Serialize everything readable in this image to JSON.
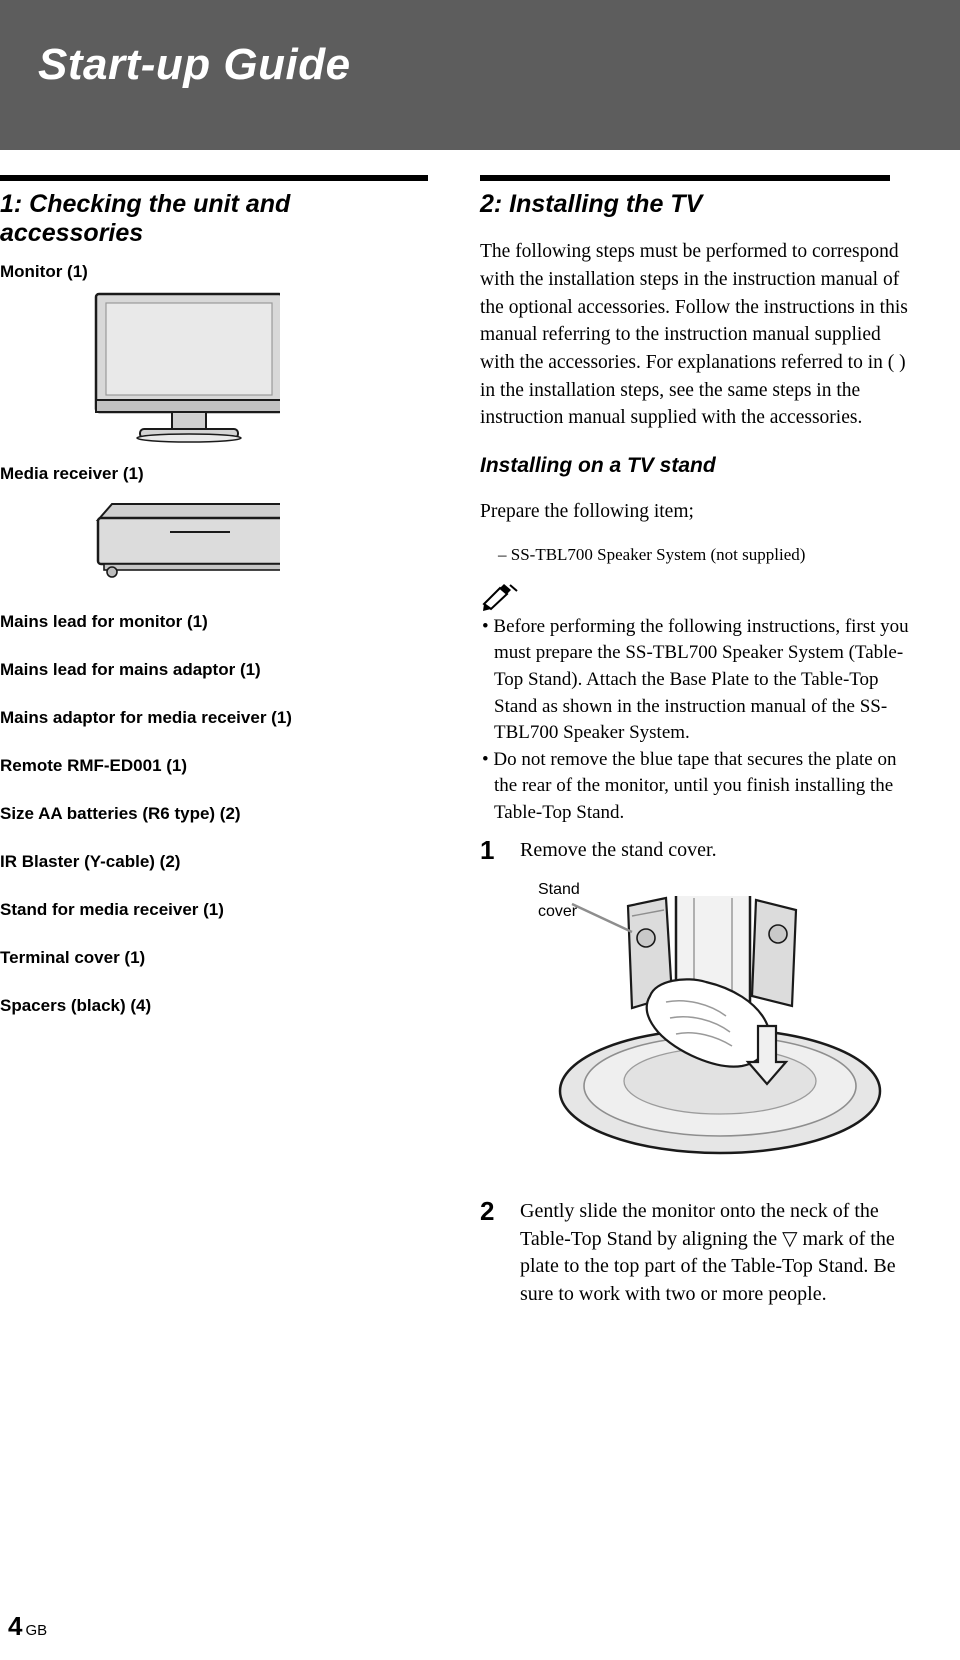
{
  "header": {
    "title": "Start-up Guide"
  },
  "left": {
    "section_title": "1: Checking the unit and accessories",
    "monitor_label": "Monitor (1)",
    "media_receiver_label": "Media receiver (1)",
    "accessories": [
      "Mains lead for monitor (1)",
      "Mains lead for mains adaptor (1)",
      "Mains adaptor for media receiver (1)",
      "Remote RMF-ED001 (1)",
      "Size AA batteries (R6 type) (2)",
      "IR Blaster (Y-cable) (2)",
      "Stand for media receiver (1)",
      "Terminal cover (1)",
      "Spacers (black) (4)"
    ]
  },
  "right": {
    "section_title": "2: Installing the TV",
    "intro": "The following steps must be performed to correspond with the installation steps in the instruction manual of the optional accessories. Follow the instructions in this manual referring to the instruction manual supplied with the accessories. For explanations referred to in ( ) in the installation steps, see the same steps in the instruction manual supplied with the accessories.",
    "subheading": "Installing on a TV stand",
    "prepare_line": "Prepare the following item;",
    "prepare_item": "–  SS-TBL700 Speaker System (not supplied)",
    "note_icon": "pencil-note-icon",
    "notes": [
      "• Before performing the following instructions, first you must prepare the SS-TBL700 Speaker System (Table-Top Stand). Attach the Base Plate to the Table-Top Stand as shown in the instruction manual of the SS-TBL700 Speaker System.",
      "• Do not remove the blue tape that secures the plate on the rear of the monitor, until you finish installing the Table-Top Stand."
    ],
    "steps": [
      {
        "num": "1",
        "text": "Remove the stand cover."
      },
      {
        "num": "2",
        "text": "Gently slide the monitor onto the neck of the Table-Top Stand by aligning the ▽ mark of the plate to the top part of the Table-Top Stand. Be sure to work with two or more people."
      }
    ],
    "figure_caption": "Stand cover"
  },
  "footer": {
    "page_number": "4",
    "region": "GB"
  }
}
